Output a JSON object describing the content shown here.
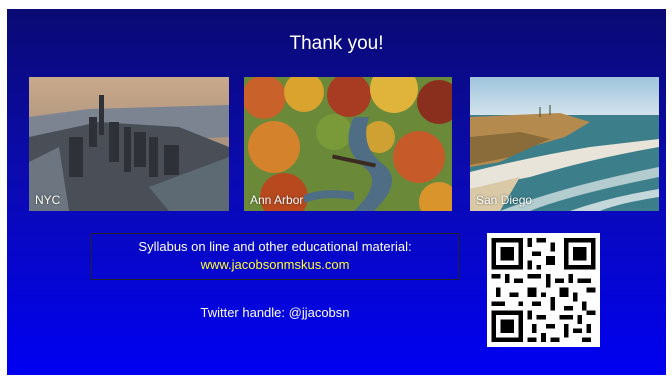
{
  "slide": {
    "title": "Thank you!",
    "photos": [
      {
        "caption": "NYC"
      },
      {
        "caption": "Ann Arbor"
      },
      {
        "caption": "San Diego"
      }
    ],
    "box": {
      "line1": "Syllabus on line and other educational material:",
      "link": "www.jacobsonmskus.com"
    },
    "twitter": "Twitter handle: @jjacobsn",
    "colors": {
      "background_top": "#0a0a73",
      "background_bottom": "#0000f2",
      "link": "#ffff33",
      "text": "#ffffff"
    },
    "qr_icon": "qr-code-icon"
  }
}
